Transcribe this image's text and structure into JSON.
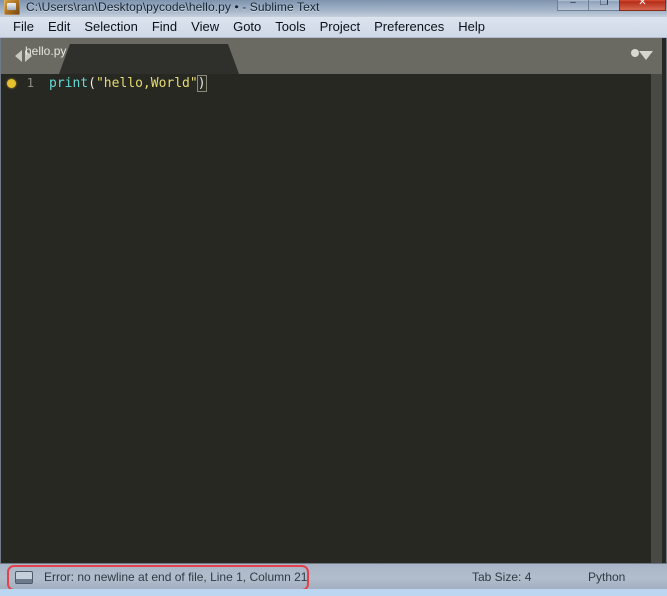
{
  "window": {
    "title": "C:\\Users\\ran\\Desktop\\pycode\\hello.py • - Sublime Text",
    "app_icon": "sublime-text-icon",
    "controls": {
      "minimize": "–",
      "maximize": "❐",
      "close": "✕"
    }
  },
  "menubar": {
    "items": [
      {
        "label": "File"
      },
      {
        "label": "Edit"
      },
      {
        "label": "Selection"
      },
      {
        "label": "Find"
      },
      {
        "label": "View"
      },
      {
        "label": "Goto"
      },
      {
        "label": "Tools"
      },
      {
        "label": "Project"
      },
      {
        "label": "Preferences"
      },
      {
        "label": "Help"
      }
    ]
  },
  "tabbar": {
    "nav_prev_icon": "triangle-left-icon",
    "nav_next_icon": "triangle-right-icon",
    "tabs": [
      {
        "label": "hello.py",
        "dirty": true
      }
    ],
    "overflow_icon": "chevron-down-icon"
  },
  "editor": {
    "bookmark_icon": "bookmark-dot-icon",
    "lines": [
      {
        "number": "1",
        "tokens": [
          {
            "text": "print",
            "type": "function"
          },
          {
            "text": "(",
            "type": "punct"
          },
          {
            "text": "\"hello,World\"",
            "type": "string"
          },
          {
            "text": ")",
            "type": "bracket-match"
          }
        ]
      }
    ],
    "colors": {
      "background": "#272822",
      "function": "#66d9d6",
      "string": "#e6db74",
      "punctuation": "#e8e8e3",
      "line_number": "#8f908a",
      "bookmark": "#e6c02f"
    }
  },
  "statusbar": {
    "panel_toggle_icon": "sidebar-toggle-icon",
    "message": "Error: no newline at end of file, Line 1, Column 21",
    "tab_size": "Tab Size: 4",
    "syntax": "Python",
    "highlight_color": "#e8404a"
  }
}
